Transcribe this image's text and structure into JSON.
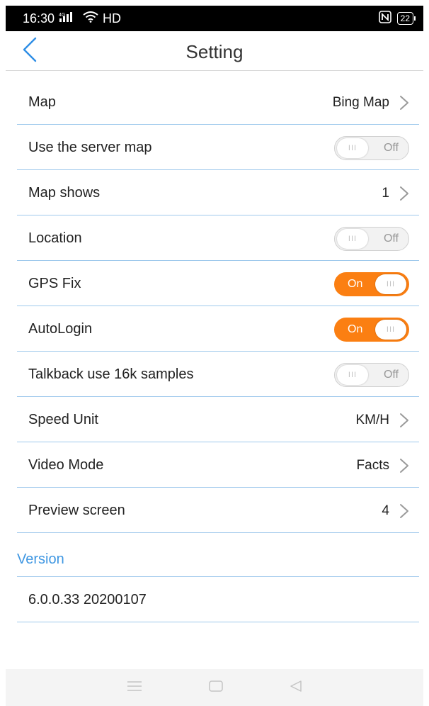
{
  "status_bar": {
    "time": "16:30",
    "signal": "4G",
    "network": "HD",
    "battery": "22"
  },
  "header": {
    "title": "Setting",
    "back_icon": "chevron-left-icon"
  },
  "settings": [
    {
      "label": "Map",
      "type": "nav",
      "value": "Bing Map"
    },
    {
      "label": "Use the server map",
      "type": "toggle",
      "on": false,
      "state_text": "Off"
    },
    {
      "label": "Map shows",
      "type": "nav",
      "value": "1"
    },
    {
      "label": "Location",
      "type": "toggle",
      "on": false,
      "state_text": "Off"
    },
    {
      "label": "GPS Fix",
      "type": "toggle",
      "on": true,
      "state_text": "On"
    },
    {
      "label": "AutoLogin",
      "type": "toggle",
      "on": true,
      "state_text": "On"
    },
    {
      "label": "Talkback use 16k samples",
      "type": "toggle",
      "on": false,
      "state_text": "Off"
    },
    {
      "label": "Speed Unit",
      "type": "nav",
      "value": "KM/H"
    },
    {
      "label": "Video Mode",
      "type": "nav",
      "value": "Facts"
    },
    {
      "label": "Preview screen",
      "type": "nav",
      "value": "4"
    }
  ],
  "version_section": {
    "title": "Version",
    "value": "6.0.0.33 20200107"
  },
  "colors": {
    "accent_on": "#fb7f12",
    "section_title": "#3f97e2",
    "divider": "#9fc9ec"
  }
}
